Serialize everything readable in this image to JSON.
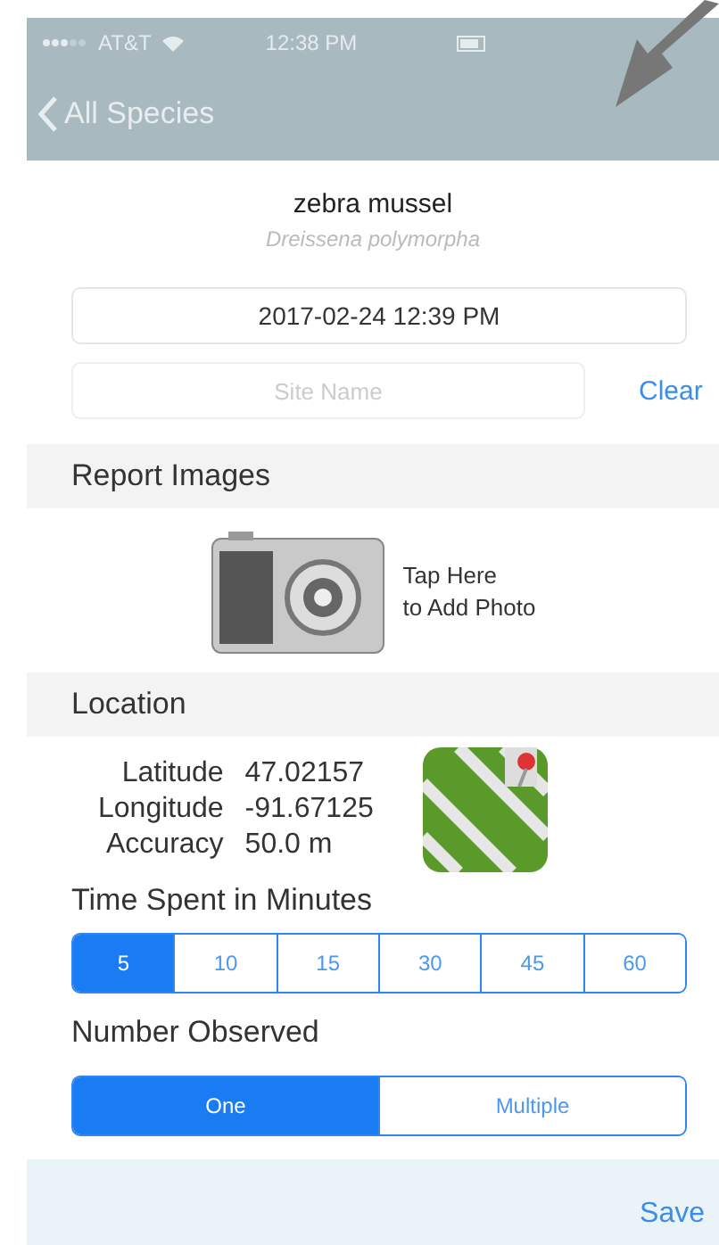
{
  "status_bar": {
    "carrier": "AT&T",
    "time": "12:38 PM"
  },
  "nav": {
    "back_label": "All Species"
  },
  "species": {
    "common_name": "zebra mussel",
    "scientific_name": "Dreissena polymorpha"
  },
  "date_field": {
    "value": "2017-02-24 12:39 PM"
  },
  "site_field": {
    "placeholder": "Site Name",
    "clear": "Clear"
  },
  "report_images": {
    "title": "Report Images",
    "prompt_lines": [
      "Tap Here",
      "to Add Photo"
    ]
  },
  "location": {
    "title": "Location",
    "rows": [
      {
        "label": "Latitude",
        "value": "47.02157"
      },
      {
        "label": "Longitude",
        "value": "-91.67125"
      },
      {
        "label": "Accuracy",
        "value": "50.0 m"
      }
    ]
  },
  "time_spent": {
    "title": "Time Spent in Minutes",
    "options": [
      {
        "label": "5",
        "selected": true
      },
      {
        "label": "10",
        "selected": false
      },
      {
        "label": "15",
        "selected": false
      },
      {
        "label": "30",
        "selected": false
      },
      {
        "label": "45",
        "selected": false
      },
      {
        "label": "60",
        "selected": false
      }
    ]
  },
  "number_observed": {
    "title": "Number Observed",
    "options": [
      {
        "label": "One",
        "selected": true
      },
      {
        "label": "Multiple",
        "selected": false
      }
    ]
  },
  "toolbar": {
    "save": "Save"
  }
}
